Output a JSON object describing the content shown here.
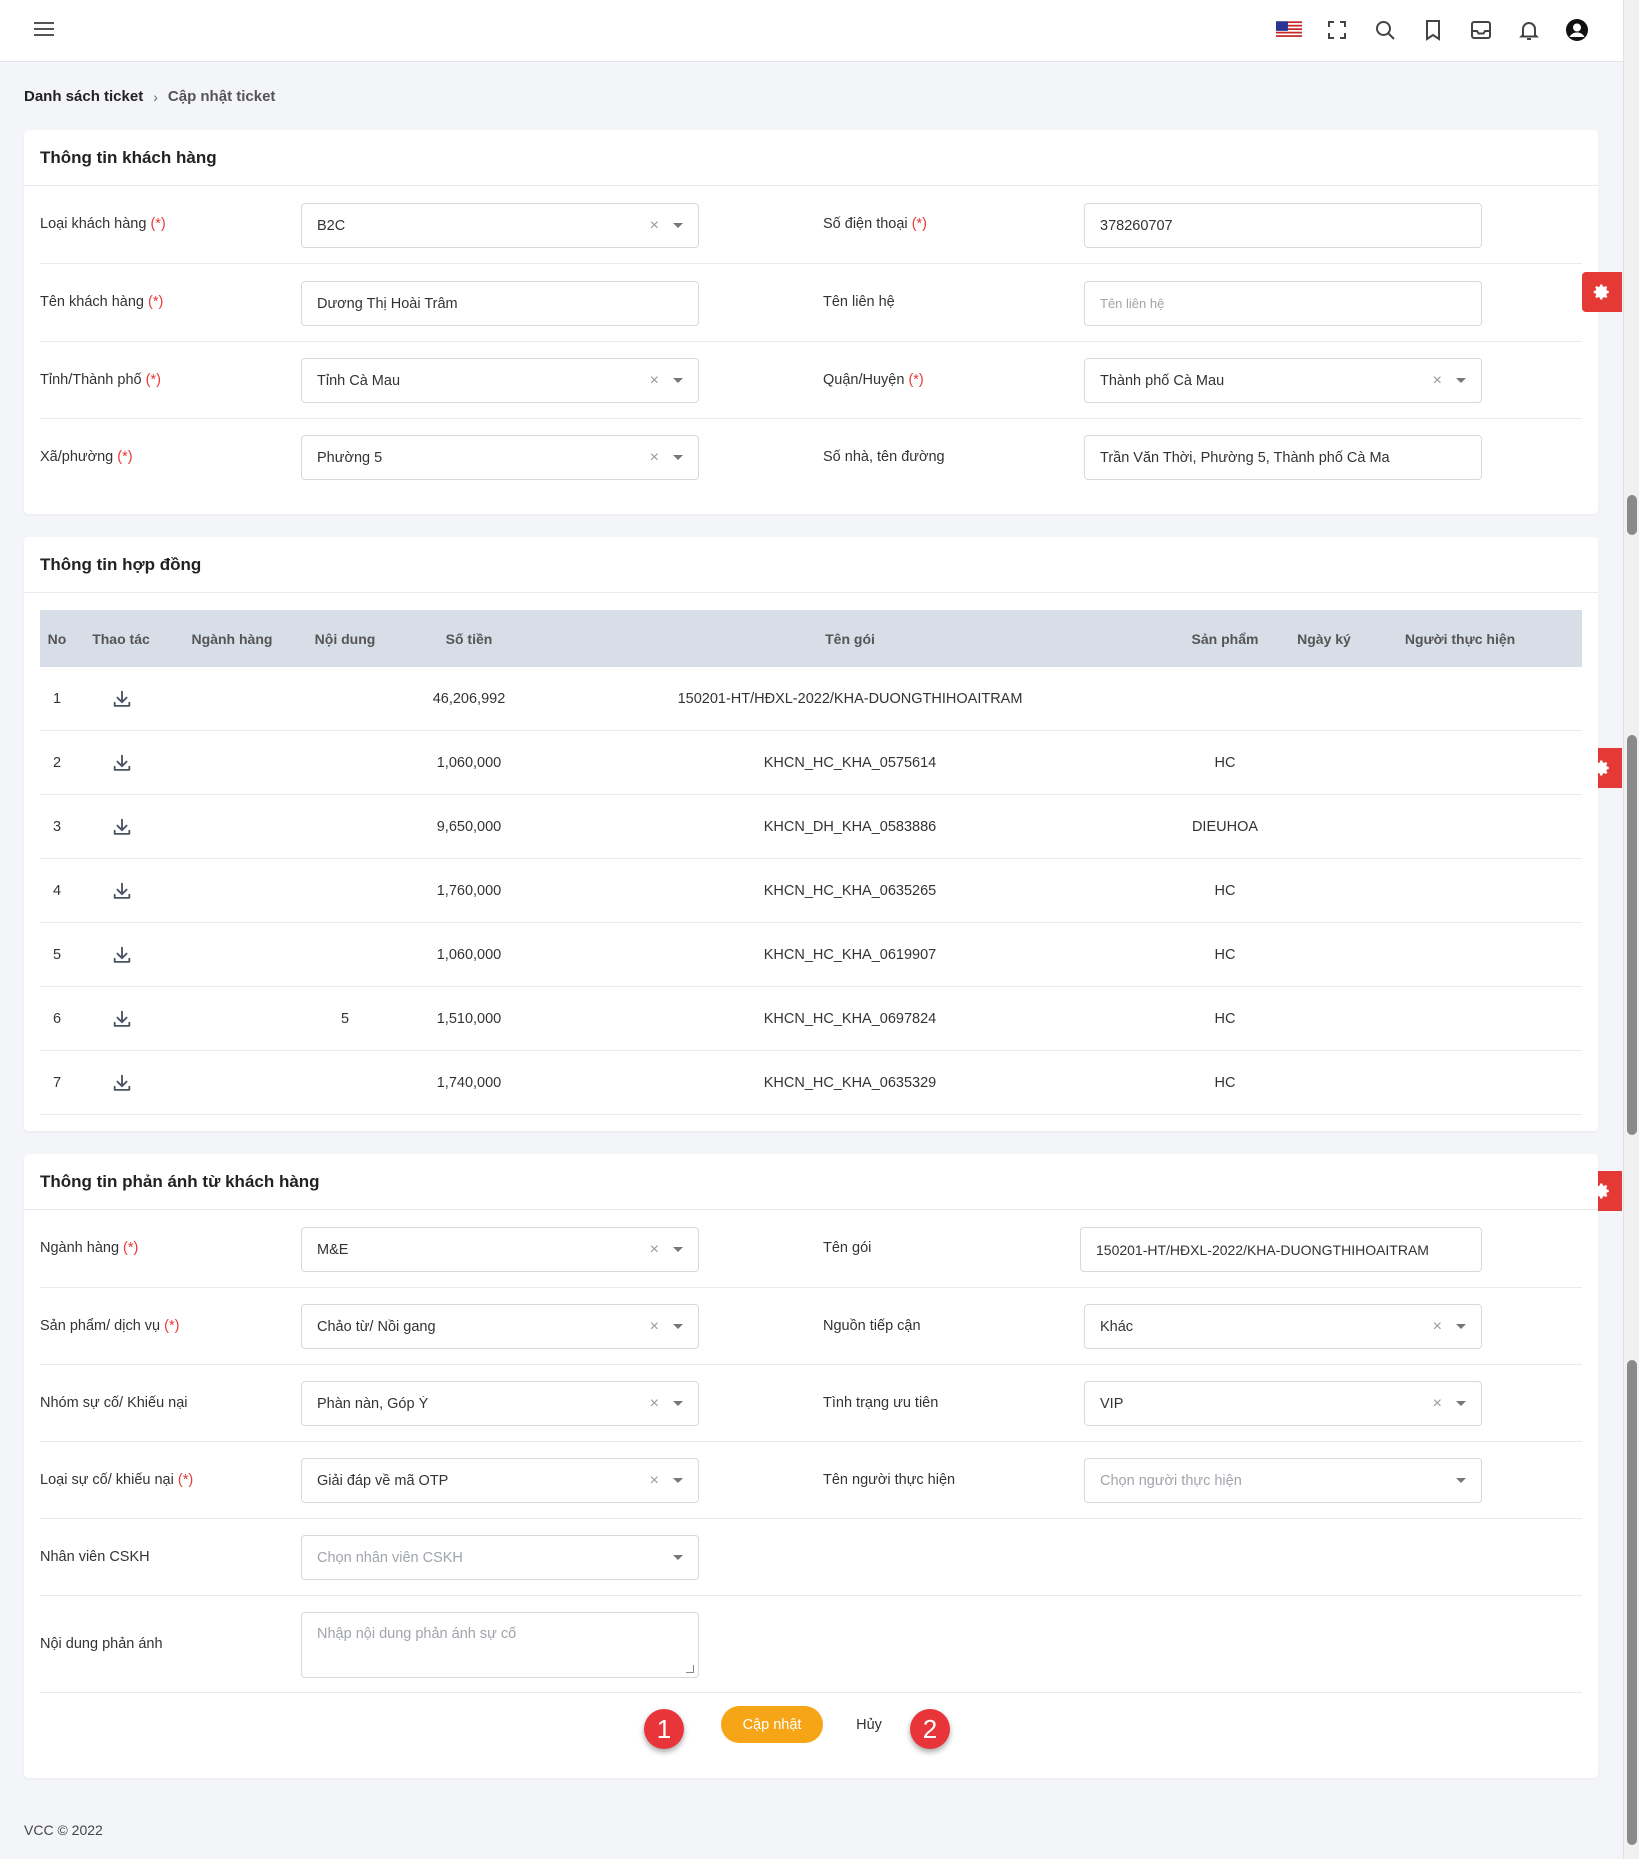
{
  "header": {
    "menu_icon": "hamburger-icon",
    "icons": [
      "us-flag-icon",
      "fullscreen-icon",
      "search-icon",
      "bookmark-icon",
      "inbox-icon",
      "bell-icon",
      "user-circle-icon"
    ]
  },
  "breadcrumb": {
    "parent": "Danh sách ticket",
    "separator": "›",
    "current": "Cập nhật ticket"
  },
  "customer": {
    "title": "Thông tin khách hàng",
    "customer_type": {
      "label": "Loại khách hàng",
      "req": "(*)",
      "value": "B2C"
    },
    "phone": {
      "label": "Số điện thoại",
      "req": "(*)",
      "value": "378260707"
    },
    "name": {
      "label": "Tên khách hàng",
      "req": "(*)",
      "value": "Dương Thị Hoài Trâm"
    },
    "contact": {
      "label": "Tên liên hệ",
      "placeholder": "Tên liên hệ"
    },
    "province": {
      "label": "Tỉnh/Thành phố",
      "req": "(*)",
      "value": "Tỉnh Cà Mau"
    },
    "district": {
      "label": "Quận/Huyện",
      "req": "(*)",
      "value": "Thành phố Cà Mau"
    },
    "ward": {
      "label": "Xã/phường",
      "req": "(*)",
      "value": "Phường 5"
    },
    "address": {
      "label": "Số nhà, tên đường",
      "value": "Trần Văn Thời, Phường 5, Thành phố Cà Ma"
    }
  },
  "contract": {
    "title": "Thông tin hợp đồng",
    "columns": [
      "No",
      "Thao tác",
      "Ngành hàng",
      "Nội dung",
      "Số tiền",
      "Tên gói",
      "Sản phẩm",
      "Ngày ký",
      "Người thực hiện"
    ],
    "rows": [
      {
        "no": "1",
        "noi_dung": "",
        "so_tien": "46,206,992",
        "ten_goi": "150201-HT/HĐXL-2022/KHA-DUONGTHIHOAITRAM",
        "san_pham": ""
      },
      {
        "no": "2",
        "noi_dung": "",
        "so_tien": "1,060,000",
        "ten_goi": "KHCN_HC_KHA_0575614",
        "san_pham": "HC"
      },
      {
        "no": "3",
        "noi_dung": "",
        "so_tien": "9,650,000",
        "ten_goi": "KHCN_DH_KHA_0583886",
        "san_pham": "DIEUHOA"
      },
      {
        "no": "4",
        "noi_dung": "",
        "so_tien": "1,760,000",
        "ten_goi": "KHCN_HC_KHA_0635265",
        "san_pham": "HC"
      },
      {
        "no": "5",
        "noi_dung": "",
        "so_tien": "1,060,000",
        "ten_goi": "KHCN_HC_KHA_0619907",
        "san_pham": "HC"
      },
      {
        "no": "6",
        "noi_dung": "5",
        "so_tien": "1,510,000",
        "ten_goi": "KHCN_HC_KHA_0697824",
        "san_pham": "HC"
      },
      {
        "no": "7",
        "noi_dung": "",
        "so_tien": "1,740,000",
        "ten_goi": "KHCN_HC_KHA_0635329",
        "san_pham": "HC"
      }
    ]
  },
  "feedback": {
    "title": "Thông tin phản ánh từ khách hàng",
    "industry": {
      "label": "Ngành hàng",
      "req": "(*)",
      "value": "M&E"
    },
    "package": {
      "label": "Tên gói",
      "value": "150201-HT/HĐXL-2022/KHA-DUONGTHIHOAITRAM"
    },
    "product": {
      "label": "Sản phẩm/ dịch vụ",
      "req": "(*)",
      "value": "Chảo từ/ Nồi gang"
    },
    "source": {
      "label": "Nguồn tiếp cận",
      "value": "Khác"
    },
    "issue_group": {
      "label": "Nhóm sự cố/ Khiếu nại",
      "value": "Phàn nàn, Góp Ý"
    },
    "priority": {
      "label": "Tình trạng ưu tiên",
      "value": "VIP"
    },
    "issue_type": {
      "label": "Loại sự cố/ khiếu nại",
      "req": "(*)",
      "value": "Giải đáp về mã OTP"
    },
    "assignee": {
      "label": "Tên người thực hiện",
      "placeholder": "Chọn người thực hiện"
    },
    "cskh": {
      "label": "Nhân viên CSKH",
      "placeholder": "Chọn nhân viên CSKH"
    },
    "content": {
      "label": "Nội dung phản ánh",
      "placeholder": "Nhập nội dung phản ánh sự cố"
    }
  },
  "actions": {
    "update": "Cập nhật",
    "cancel": "Hủy",
    "marker1": "1",
    "marker2": "2"
  },
  "footer": {
    "text": "VCC © 2022"
  },
  "colors": {
    "accent": "#f5a516",
    "danger": "#e53935",
    "table_head": "#d7dee8"
  }
}
